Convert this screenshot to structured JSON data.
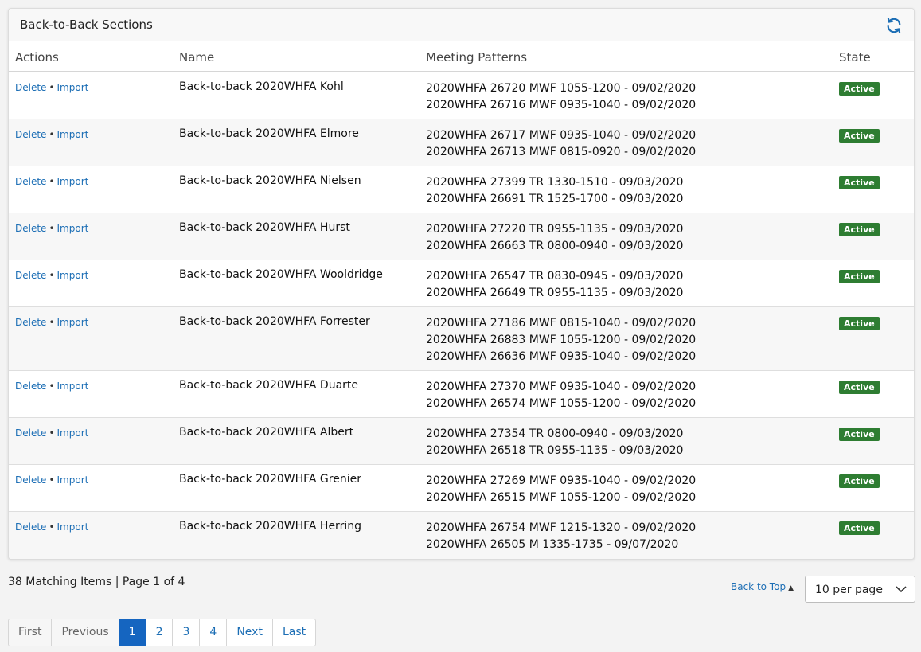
{
  "panel": {
    "title": "Back-to-Back Sections",
    "columns": {
      "actions": "Actions",
      "name": "Name",
      "meeting": "Meeting Patterns",
      "state": "State"
    }
  },
  "colors": {
    "link": "#1c6eb5",
    "active_badge": "#2e7d32",
    "current_page": "#1565c0"
  },
  "actions": {
    "delete": "Delete",
    "separator": "•",
    "import": "Import"
  },
  "rows": [
    {
      "name": "Back-to-back 2020WHFA Kohl",
      "meetings": [
        "2020WHFA 26720 MWF 1055-1200 - 09/02/2020",
        "2020WHFA 26716 MWF 0935-1040 - 09/02/2020"
      ],
      "state": "Active"
    },
    {
      "name": "Back-to-back 2020WHFA Elmore",
      "meetings": [
        "2020WHFA 26717 MWF 0935-1040 - 09/02/2020",
        "2020WHFA 26713 MWF 0815-0920 - 09/02/2020"
      ],
      "state": "Active"
    },
    {
      "name": "Back-to-back 2020WHFA Nielsen",
      "meetings": [
        "2020WHFA 27399 TR 1330-1510 - 09/03/2020",
        "2020WHFA 26691 TR 1525-1700 - 09/03/2020"
      ],
      "state": "Active"
    },
    {
      "name": "Back-to-back 2020WHFA Hurst",
      "meetings": [
        "2020WHFA 27220 TR 0955-1135 - 09/03/2020",
        "2020WHFA 26663 TR 0800-0940 - 09/03/2020"
      ],
      "state": "Active"
    },
    {
      "name": "Back-to-back 2020WHFA Wooldridge",
      "meetings": [
        "2020WHFA 26547 TR 0830-0945 - 09/03/2020",
        "2020WHFA 26649 TR 0955-1135 - 09/03/2020"
      ],
      "state": "Active"
    },
    {
      "name": "Back-to-back 2020WHFA Forrester",
      "meetings": [
        "2020WHFA 27186 MWF 0815-1040 - 09/02/2020",
        "2020WHFA 26883 MWF 1055-1200 - 09/02/2020",
        "2020WHFA 26636 MWF 0935-1040 - 09/02/2020"
      ],
      "state": "Active"
    },
    {
      "name": "Back-to-back 2020WHFA Duarte",
      "meetings": [
        "2020WHFA 27370 MWF 0935-1040 - 09/02/2020",
        "2020WHFA 26574 MWF 1055-1200 - 09/02/2020"
      ],
      "state": "Active"
    },
    {
      "name": "Back-to-back 2020WHFA Albert",
      "meetings": [
        "2020WHFA 27354 TR 0800-0940 - 09/03/2020",
        "2020WHFA 26518 TR 0955-1135 - 09/03/2020"
      ],
      "state": "Active"
    },
    {
      "name": "Back-to-back 2020WHFA Grenier",
      "meetings": [
        "2020WHFA 27269 MWF 0935-1040 - 09/02/2020",
        "2020WHFA 26515 MWF 1055-1200 - 09/02/2020"
      ],
      "state": "Active"
    },
    {
      "name": "Back-to-back 2020WHFA Herring",
      "meetings": [
        "2020WHFA 26754 MWF 1215-1320 - 09/02/2020",
        "2020WHFA 26505 M 1335-1735 - 09/07/2020"
      ],
      "state": "Active"
    }
  ],
  "footer": {
    "matching": "38 Matching Items | Page 1 of 4",
    "back_to_top": "Back to Top",
    "back_to_top_icon": "triangle-up-icon",
    "per_page": "10 per page"
  },
  "pagination": {
    "first": "First",
    "previous": "Previous",
    "pages": [
      "1",
      "2",
      "3",
      "4"
    ],
    "current": "1",
    "next": "Next",
    "last": "Last"
  }
}
